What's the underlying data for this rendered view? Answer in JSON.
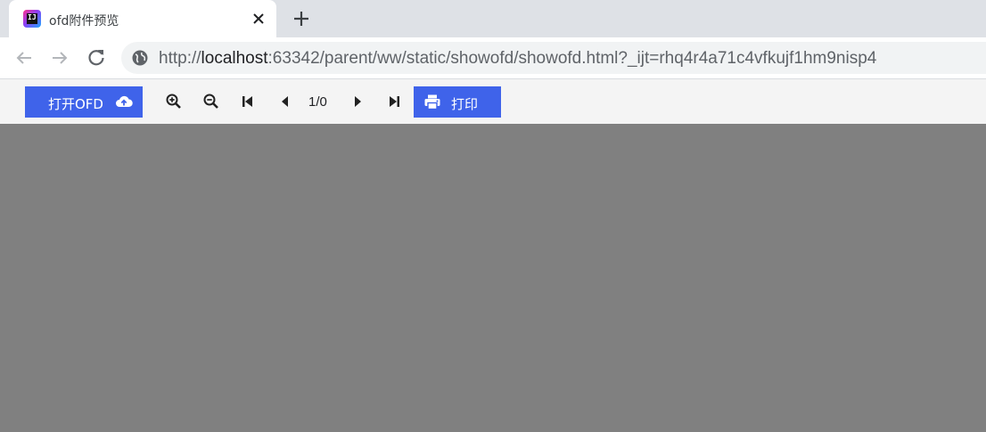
{
  "tab": {
    "title": "ofd附件预览",
    "favicon_glyph": "IJ",
    "close_icon": "close-icon",
    "new_tab_icon": "plus-icon"
  },
  "nav": {
    "back_icon": "arrow-left-icon",
    "forward_icon": "arrow-right-icon",
    "reload_icon": "reload-icon",
    "site_info_icon": "globe-icon",
    "url_scheme": "http://",
    "url_host": "localhost",
    "url_rest": ":63342/parent/ww/static/showofd/showofd.html?_ijt=rhq4r4a71c4vfkujf1hm9nisp4"
  },
  "toolbar": {
    "open_label": "打开OFD",
    "open_icon": "cloud-upload-icon",
    "zoom_in_icon": "zoom-in-icon",
    "zoom_out_icon": "zoom-out-icon",
    "first_page_icon": "first-page-icon",
    "prev_page_icon": "prev-page-icon",
    "page_indicator": "1/0",
    "next_page_icon": "next-page-icon",
    "last_page_icon": "last-page-icon",
    "print_label": "打印",
    "print_icon": "print-icon"
  },
  "colors": {
    "primary": "#3f63ea",
    "viewer_bg": "#808080",
    "toolbar_bg": "#f4f4f4",
    "tabstrip_bg": "#dee1e6"
  }
}
